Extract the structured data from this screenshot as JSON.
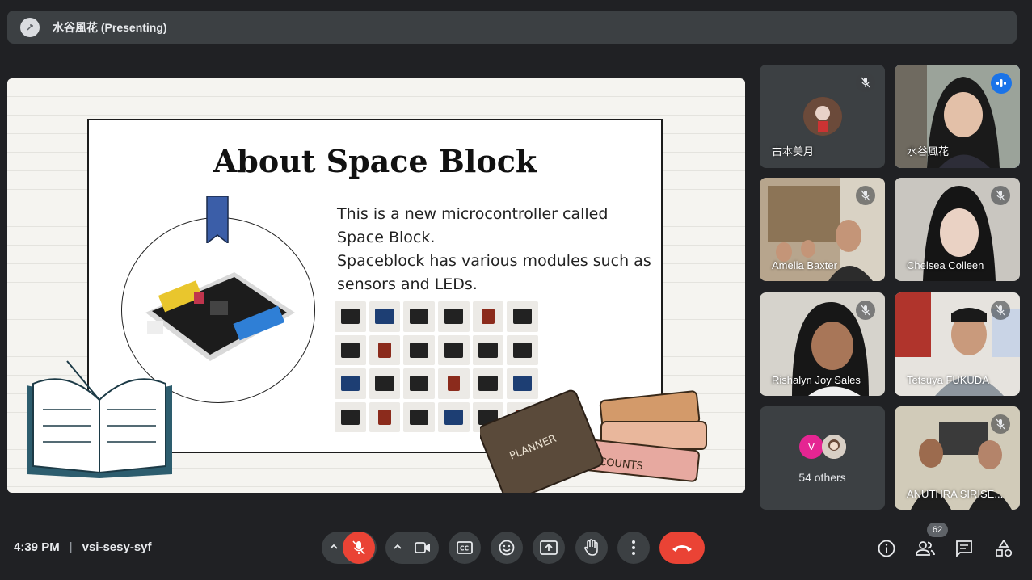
{
  "presenter_bar": {
    "title": "水谷風花 (Presenting)"
  },
  "slide": {
    "title": "About Space Block",
    "body_lines": [
      "This is a new microcontroller called",
      "Space Block.",
      "Spaceblock has various modules such as",
      "sensors and LEDs."
    ],
    "planner_label": "PLANNER",
    "accounts_label": "ACCOUNTS"
  },
  "participants": [
    {
      "name": "古本美月",
      "muted": true
    },
    {
      "name": "水谷風花",
      "speaking": true
    },
    {
      "name": "Amelia Baxter",
      "muted": true
    },
    {
      "name": "Chelsea Colleen",
      "muted": true
    },
    {
      "name": "Rishalyn Joy Sales",
      "muted": true
    },
    {
      "name": "Tetsuya FUKUDA",
      "muted": true
    },
    {
      "name": "ANUTHRA SIRISE...",
      "muted": true
    }
  ],
  "others": {
    "label": "54 others",
    "initial": "V"
  },
  "meeting": {
    "time": "4:39 PM",
    "code": "vsi-sesy-syf"
  },
  "people_count": "62",
  "colors": {
    "end_call": "#ea4335",
    "active_speaker": "#8ab4f8",
    "tile_bg": "#3c4043"
  }
}
